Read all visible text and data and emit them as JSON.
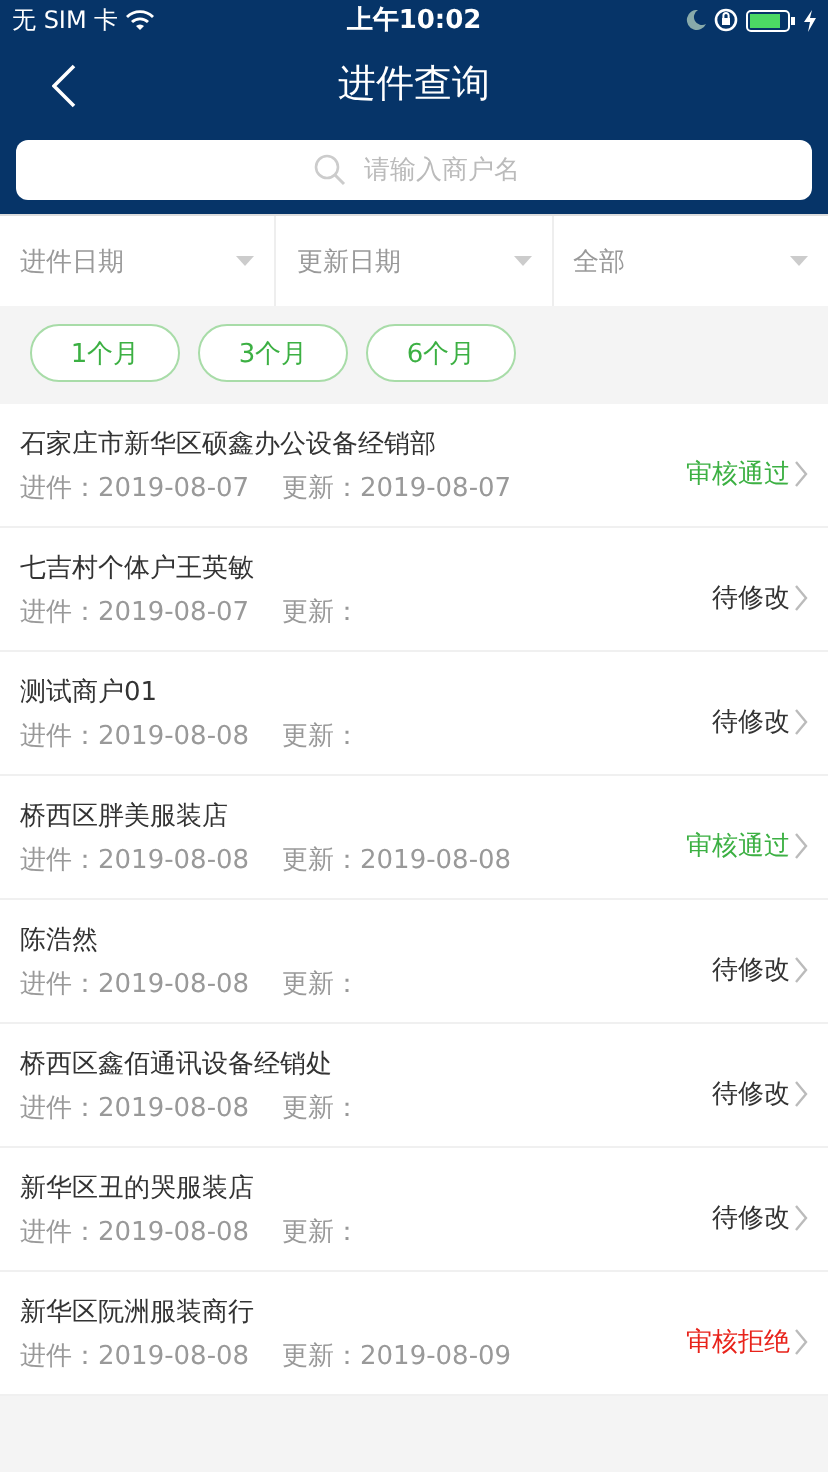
{
  "status_bar": {
    "carrier": "无 SIM 卡",
    "time": "上午10:02"
  },
  "nav": {
    "title": "进件查询"
  },
  "search": {
    "placeholder": "请输入商户名"
  },
  "filters": [
    {
      "label": "进件日期"
    },
    {
      "label": "更新日期"
    },
    {
      "label": "全部"
    }
  ],
  "periods": [
    {
      "label": "1个月",
      "selected": false
    },
    {
      "label": "3个月",
      "selected": false
    },
    {
      "label": "6个月",
      "selected": false
    }
  ],
  "merchants": [
    {
      "name": "石家庄市新华区硕鑫办公设备经销部",
      "submitted": "进件：2019-08-07",
      "updated": "更新：2019-08-07",
      "status": "审核通过",
      "kind": "approved"
    },
    {
      "name": "七吉村个体户王英敏",
      "submitted": "进件：2019-08-07",
      "updated": "更新：",
      "status": "待修改",
      "kind": "pending"
    },
    {
      "name": "测试商户01",
      "submitted": "进件：2019-08-08",
      "updated": "更新：",
      "status": "待修改",
      "kind": "pending"
    },
    {
      "name": "桥西区胖美服装店",
      "submitted": "进件：2019-08-08",
      "updated": "更新：2019-08-08",
      "status": "审核通过",
      "kind": "approved"
    },
    {
      "name": "陈浩然",
      "submitted": "进件：2019-08-08",
      "updated": "更新：",
      "status": "待修改",
      "kind": "pending"
    },
    {
      "name": "桥西区鑫佰通讯设备经销处",
      "submitted": "进件：2019-08-08",
      "updated": "更新：",
      "status": "待修改",
      "kind": "pending"
    },
    {
      "name": "新华区丑的哭服装店",
      "submitted": "进件：2019-08-08",
      "updated": "更新：",
      "status": "待修改",
      "kind": "pending"
    },
    {
      "name": "新华区阮洲服装商行",
      "submitted": "进件：2019-08-08",
      "updated": "更新：2019-08-09",
      "status": "审核拒绝",
      "kind": "rejected"
    }
  ]
}
